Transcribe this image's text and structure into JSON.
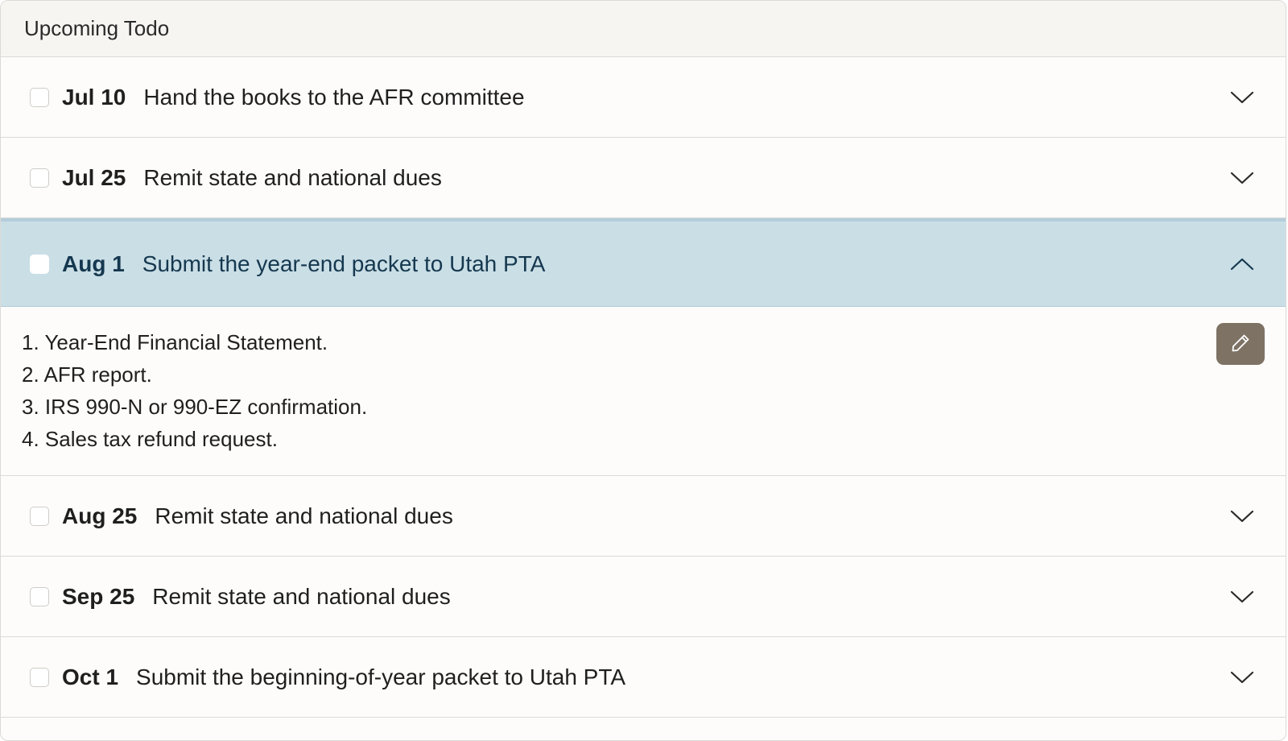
{
  "header": {
    "title": "Upcoming Todo"
  },
  "todos": [
    {
      "date": "Jul 10",
      "title": "Hand the books to the AFR committee",
      "expanded": false
    },
    {
      "date": "Jul 25",
      "title": "Remit state and national dues",
      "expanded": false
    },
    {
      "date": "Aug 1",
      "title": "Submit the year-end packet to Utah PTA",
      "expanded": true,
      "details": [
        "1. Year-End Financial Statement.",
        "2. AFR report.",
        "3. IRS 990-N or 990-EZ confirmation.",
        "4. Sales tax refund request."
      ]
    },
    {
      "date": "Aug 25",
      "title": "Remit state and national dues",
      "expanded": false
    },
    {
      "date": "Sep 25",
      "title": "Remit state and national dues",
      "expanded": false
    },
    {
      "date": "Oct 1",
      "title": "Submit the beginning-of-year packet to Utah PTA",
      "expanded": false
    }
  ],
  "icons": {
    "collapsed": "chevron-down-icon",
    "expanded": "chevron-up-icon",
    "edit": "pencil-icon"
  },
  "colors": {
    "expanded_row_bg": "#cadee6",
    "expanded_text": "#15384f",
    "edit_button_bg": "#7d7264"
  }
}
